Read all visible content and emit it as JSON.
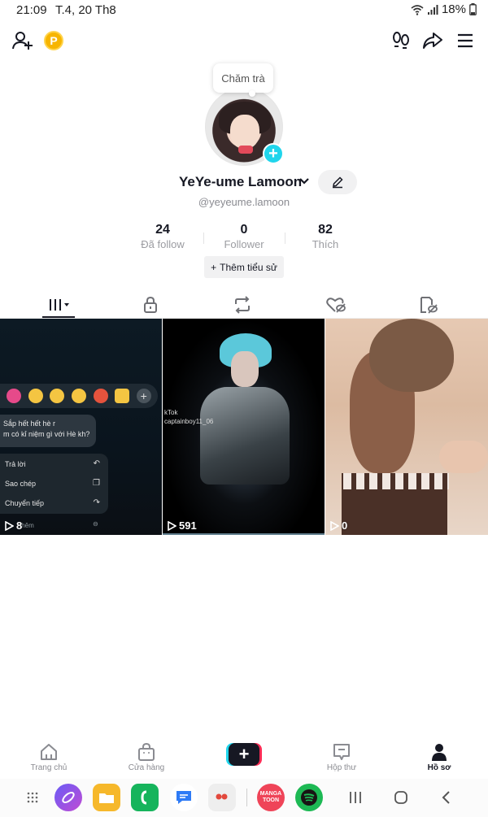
{
  "status_bar": {
    "time": "21:09",
    "date": "T.4, 20 Th8",
    "battery": "18%"
  },
  "profile": {
    "bubble_text": "Chăm trà",
    "display_name": "YeYe-ume Lamoon",
    "handle": "@yeyeume.lamoon",
    "stats": [
      {
        "value": "24",
        "label": "Đã follow"
      },
      {
        "value": "0",
        "label": "Follower"
      },
      {
        "value": "82",
        "label": "Thích"
      }
    ],
    "bio_button": "Thêm tiểu sử"
  },
  "tabs": [
    {
      "icon": "grid-icon",
      "active": true
    },
    {
      "icon": "lock-icon",
      "active": false
    },
    {
      "icon": "repost-icon",
      "active": false
    },
    {
      "icon": "liked-icon",
      "active": false
    },
    {
      "icon": "tagged-icon",
      "active": false
    }
  ],
  "videos": [
    {
      "views": "8",
      "message": "Sắp hết hết hè r\nm có kỉ niệm gì với Hè kh?",
      "menu": [
        "Trả lời",
        "Sao chép",
        "Chuyển tiếp"
      ],
      "more": "thêm"
    },
    {
      "views": "591",
      "overlay": "kTok\ncaptainboy11_06"
    },
    {
      "views": "0"
    }
  ],
  "bottom_nav": [
    {
      "label": "Trang chủ",
      "icon": "home-icon"
    },
    {
      "label": "Cửa hàng",
      "icon": "shop-icon"
    },
    {
      "label": "",
      "icon": "create-icon"
    },
    {
      "label": "Hộp thư",
      "icon": "inbox-icon"
    },
    {
      "label": "Hồ sơ",
      "icon": "profile-icon",
      "active": true
    }
  ],
  "dock": {
    "manga_label": "MANGA TOON"
  },
  "colors": {
    "accent_cyan": "#20d5ec",
    "accent_red": "#fe2c55",
    "text_primary": "#161823",
    "text_secondary": "#8a8b91"
  }
}
